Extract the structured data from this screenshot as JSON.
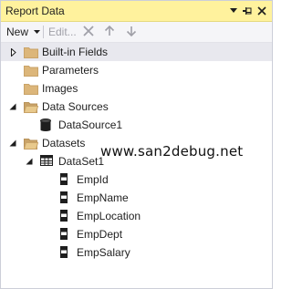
{
  "window": {
    "title": "Report Data"
  },
  "toolbar": {
    "new_label": "New",
    "edit_label": "Edit..."
  },
  "tree": {
    "items": [
      {
        "label": "Built-in Fields"
      },
      {
        "label": "Parameters"
      },
      {
        "label": "Images"
      },
      {
        "label": "Data Sources"
      },
      {
        "label": "DataSource1"
      },
      {
        "label": "Datasets"
      },
      {
        "label": "DataSet1"
      },
      {
        "label": "EmpId"
      },
      {
        "label": "EmpName"
      },
      {
        "label": "EmpLocation"
      },
      {
        "label": "EmpDept"
      },
      {
        "label": "EmpSalary"
      }
    ]
  },
  "watermark": "www.san2debug.net",
  "colors": {
    "titlebar_bg": "#fff29d",
    "folder": "#dcb67a",
    "folder_shade": "#c9a368",
    "selected_row": "#e8e8ee",
    "disabled": "#a0a0a8"
  }
}
